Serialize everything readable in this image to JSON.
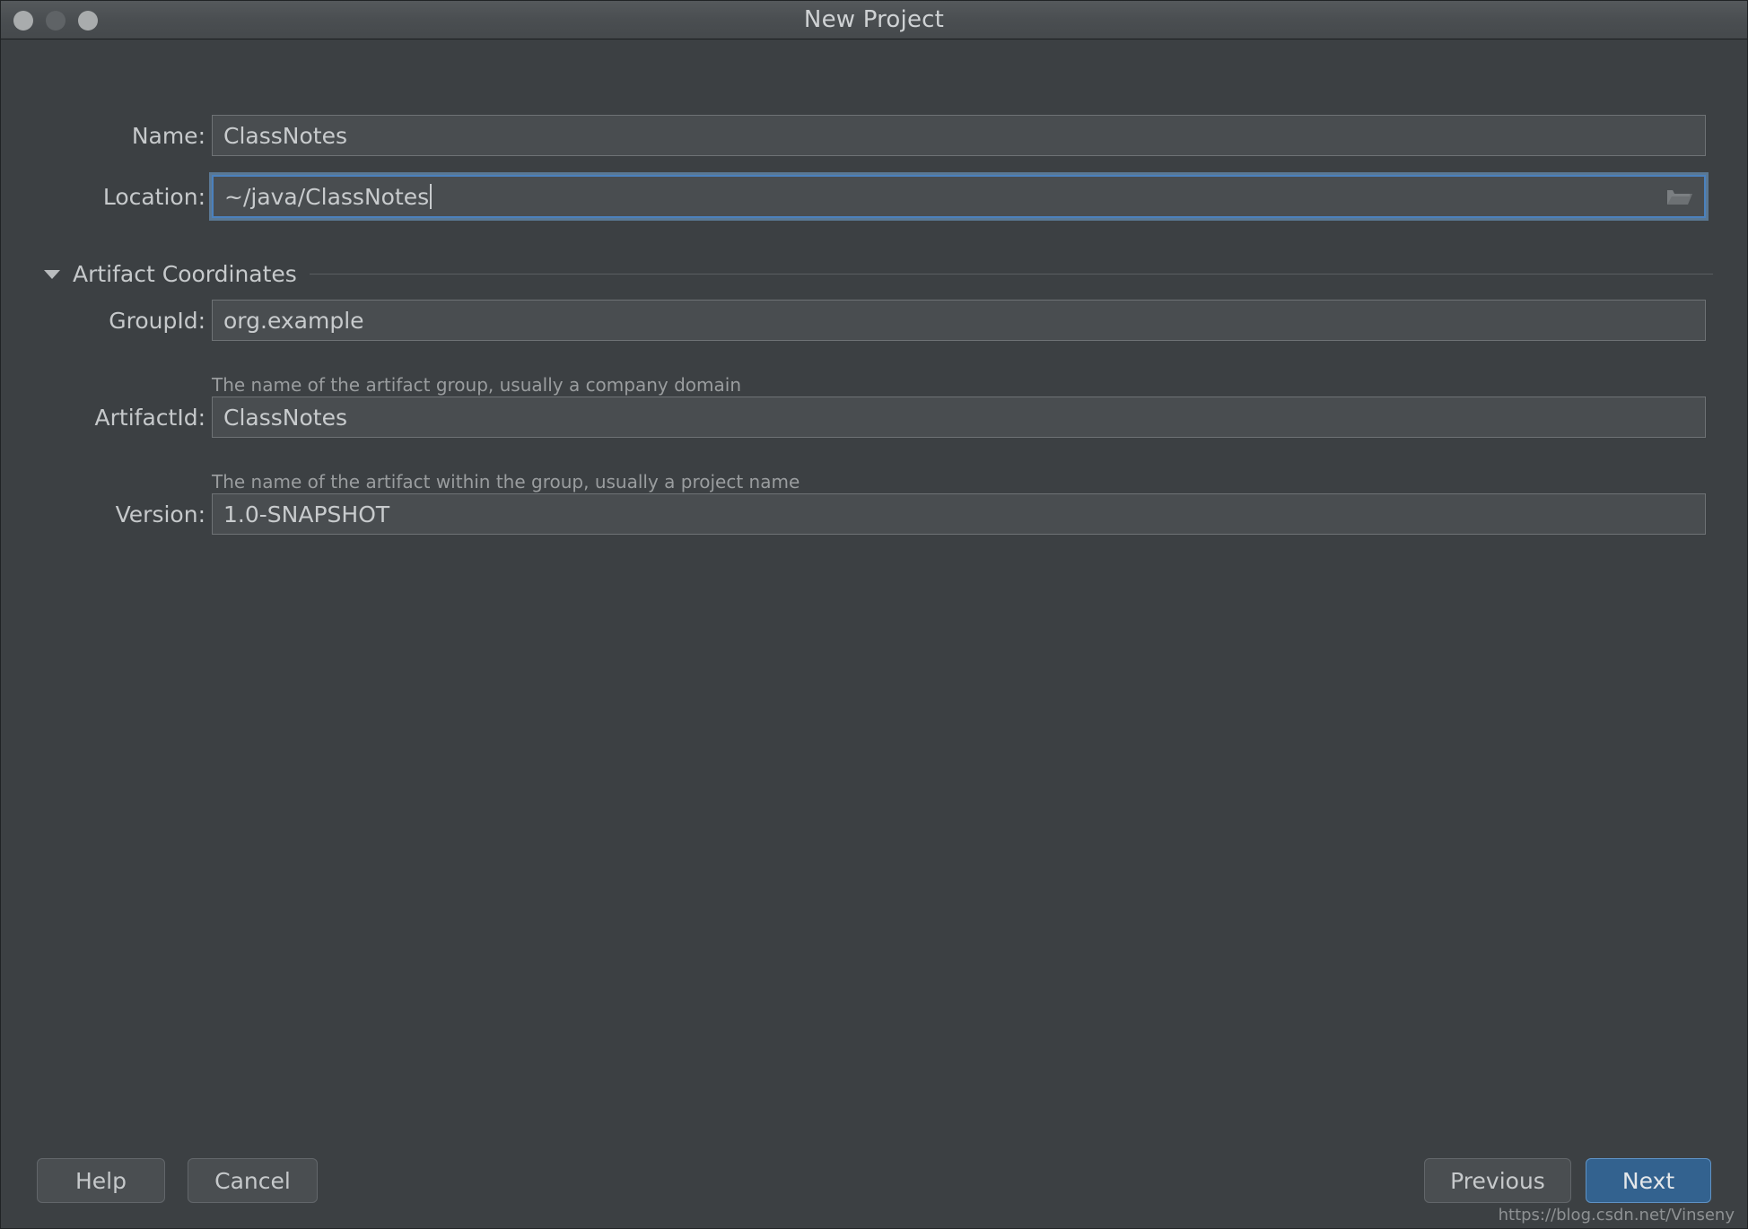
{
  "window": {
    "title": "New Project",
    "traffic_lights": [
      "close",
      "minimize",
      "zoom"
    ]
  },
  "form": {
    "name": {
      "label": "Name:",
      "value": "ClassNotes",
      "placeholder": ""
    },
    "location": {
      "label": "Location:",
      "value": "~/java/ClassNotes",
      "placeholder": "",
      "focused": true,
      "browse_icon": "folder-icon"
    }
  },
  "artifact_section": {
    "title": "Artifact Coordinates",
    "expanded": true,
    "toggle_icon": "chevron-down-icon",
    "fields": {
      "group_id": {
        "label": "GroupId:",
        "value": "org.example",
        "hint": "The name of the artifact group, usually a company domain"
      },
      "artifact_id": {
        "label": "ArtifactId:",
        "value": "ClassNotes",
        "hint": "The name of the artifact within the group, usually a project name"
      },
      "version": {
        "label": "Version:",
        "value": "1.0-SNAPSHOT",
        "hint": ""
      }
    }
  },
  "footer": {
    "help_label": "Help",
    "cancel_label": "Cancel",
    "previous_label": "Previous",
    "next_label": "Next"
  },
  "watermark": {
    "text": "https://blog.csdn.net/Vinseny"
  },
  "colors": {
    "background": "#3c4043",
    "field_background": "#494d50",
    "field_border": "#6e7275",
    "focus_border": "#4b81bd",
    "primary_button": "#33628f",
    "text": "#c6c9cb",
    "hint_text": "#9a9d9f"
  }
}
